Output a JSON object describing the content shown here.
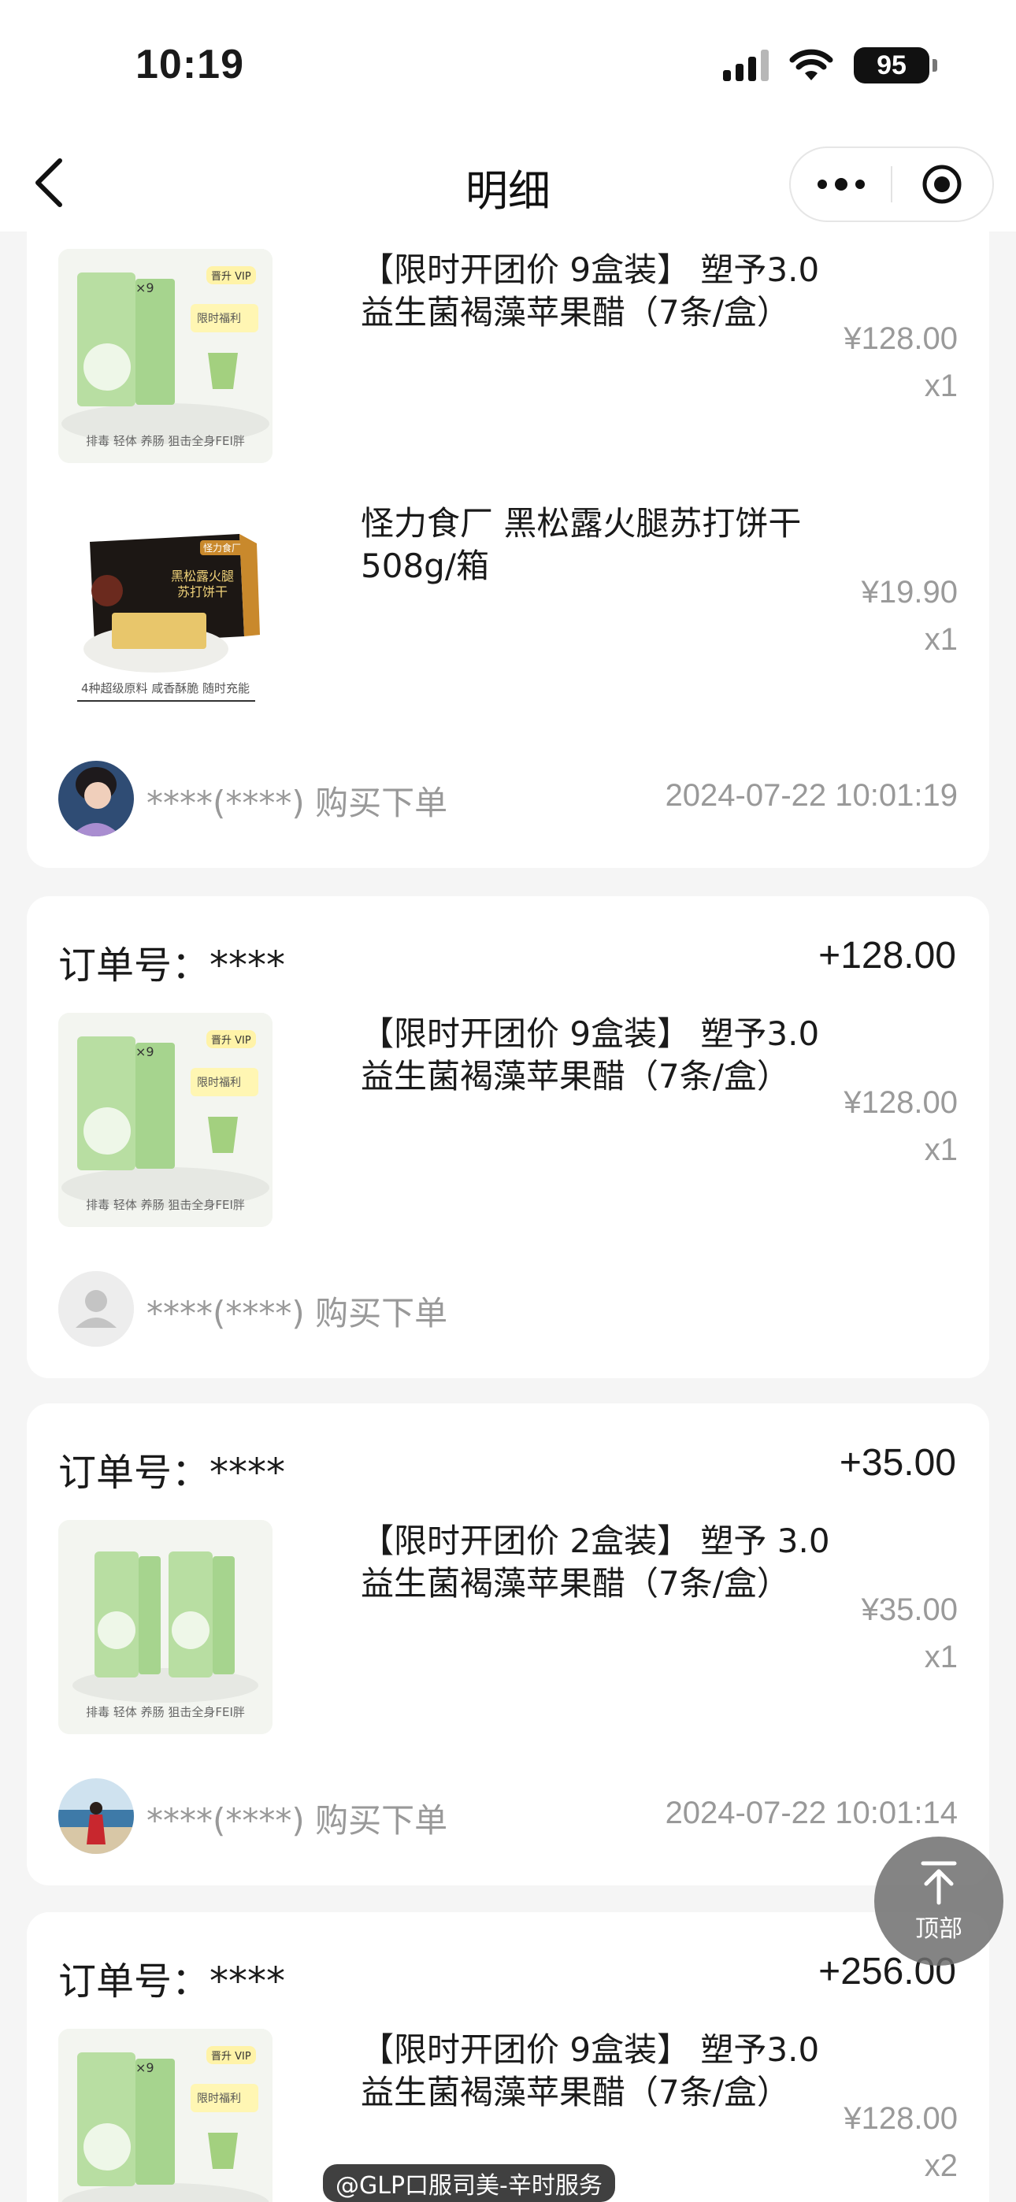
{
  "status_bar": {
    "time": "10:19",
    "battery": "95"
  },
  "nav": {
    "title": "明细"
  },
  "orders": [
    {
      "items": [
        {
          "name": "【限时开团价 9盒装】 塑予3.0益生菌褐藻苹果醋（7条/盒）",
          "price": "¥128.00",
          "qty": "x1",
          "thumb_caption": "排毒 轻体 养肠 狙击全身FEI胖",
          "thumb_badge": "晋升 VIP",
          "thumb_tag": "×9",
          "thumb_label": "限时福利"
        },
        {
          "name": "怪力食厂 黑松露火腿苏打饼干508g/箱",
          "price": "¥19.90",
          "qty": "x1",
          "thumb_caption": "4种超级原料 咸香酥脆 随时充能",
          "thumb_brand": "怪力食厂",
          "thumb_box_title": "黑松露火腿苏打饼干"
        }
      ],
      "buyer": {
        "text": "****(****) 购买下单",
        "time": "2024-07-22 10:01:19"
      }
    },
    {
      "order_label": "订单号：****",
      "amount": "+128.00",
      "items": [
        {
          "name": "【限时开团价 9盒装】 塑予3.0益生菌褐藻苹果醋（7条/盒）",
          "price": "¥128.00",
          "qty": "x1",
          "thumb_caption": "排毒 轻体 养肠 狙击全身FEI胖",
          "thumb_badge": "晋升 VIP",
          "thumb_tag": "×9",
          "thumb_label": "限时福利"
        }
      ],
      "buyer": {
        "text": "****(****) 购买下单",
        "time": ""
      }
    },
    {
      "order_label": "订单号：****",
      "amount": "+35.00",
      "items": [
        {
          "name": "【限时开团价 2盒装】 塑予 3.0益生菌褐藻苹果醋（7条/盒）",
          "price": "¥35.00",
          "qty": "x1",
          "thumb_caption": "排毒 轻体 养肠 狙击全身FEI胖"
        }
      ],
      "buyer": {
        "text": "****(****) 购买下单",
        "time": "2024-07-22 10:01:14"
      }
    },
    {
      "order_label": "订单号：****",
      "amount": "+256.00",
      "items": [
        {
          "name": "【限时开团价 9盒装】 塑予3.0益生菌褐藻苹果醋（7条/盒）",
          "price": "¥128.00",
          "qty": "x2",
          "thumb_badge": "晋升 VIP",
          "thumb_tag": "×9",
          "thumb_label": "限时福利"
        }
      ]
    }
  ],
  "top_button": {
    "label": "顶部"
  },
  "watermark": "@GLP口服司美-辛时服务",
  "colors": {
    "page_bg": "#f5f5f5",
    "card_bg": "#ffffff",
    "muted": "#999999",
    "thumb_green": "#b9dfa4"
  },
  "icons": {
    "back": "chevron-left-icon",
    "more": "more-dots-icon",
    "target": "target-icon",
    "top": "arrow-up-icon",
    "placeholder_avatar": "user-placeholder-icon"
  }
}
